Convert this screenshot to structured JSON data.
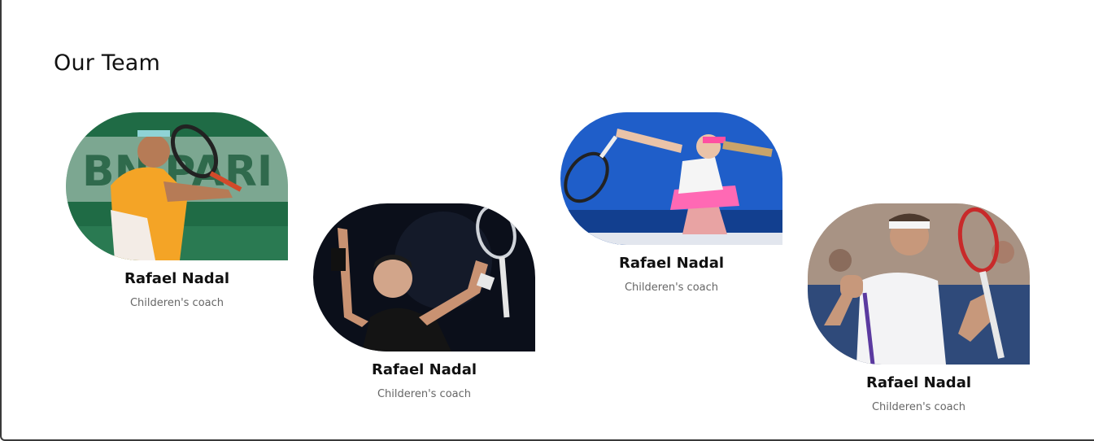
{
  "section": {
    "title": "Our Team"
  },
  "team": [
    {
      "name": "Rafael Nadal",
      "role": "Childeren's coach",
      "photo_alt": "Tennis player hitting a forehand"
    },
    {
      "name": "Rafael Nadal",
      "role": "Childeren's coach",
      "photo_alt": "Tennis player celebrating with raised arms"
    },
    {
      "name": "Rafael Nadal",
      "role": "Childeren's coach",
      "photo_alt": "Tennis player serving"
    },
    {
      "name": "Rafael Nadal",
      "role": "Childeren's coach",
      "photo_alt": "Tennis player celebrating with racket"
    }
  ],
  "colors": {
    "title": "#111111",
    "name": "#111111",
    "role": "#666666",
    "background": "#ffffff"
  }
}
